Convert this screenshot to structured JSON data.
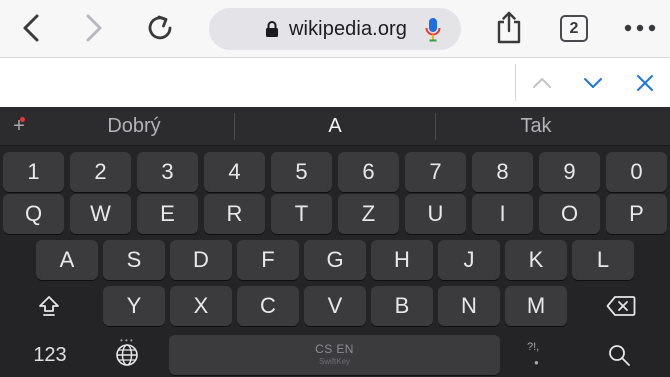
{
  "toolbar": {
    "url": "wikipedia.org",
    "tab_count": "2",
    "icons": {
      "back": "chevron-left-icon",
      "forward": "chevron-right-icon",
      "reload": "reload-icon",
      "lock": "lock-icon",
      "mic": "microphone-icon",
      "share": "share-icon",
      "tabs": "tabs-icon",
      "more": "more-icon"
    }
  },
  "find_bar": {
    "value": "",
    "placeholder": "",
    "icons": {
      "prev": "chevron-up-icon",
      "next": "chevron-down-icon",
      "close": "close-icon"
    }
  },
  "keyboard": {
    "predictions": [
      "Dobrý",
      "A",
      "Tak"
    ],
    "number_row": [
      "1",
      "2",
      "3",
      "4",
      "5",
      "6",
      "7",
      "8",
      "9",
      "0"
    ],
    "row1": [
      "Q",
      "W",
      "E",
      "R",
      "T",
      "Z",
      "U",
      "I",
      "O",
      "P"
    ],
    "row2": [
      "A",
      "S",
      "D",
      "F",
      "G",
      "H",
      "J",
      "K",
      "L"
    ],
    "row3": [
      "Y",
      "X",
      "C",
      "V",
      "B",
      "N",
      "M"
    ],
    "numbers_key": "123",
    "space_language": "CS EN",
    "space_brand": "SwiftKey",
    "symbols_label": "?!,",
    "colors": {
      "mic_blue": "#1e6fe0",
      "mic_red": "#e53935",
      "accent_blue": "#1e72e8"
    }
  }
}
